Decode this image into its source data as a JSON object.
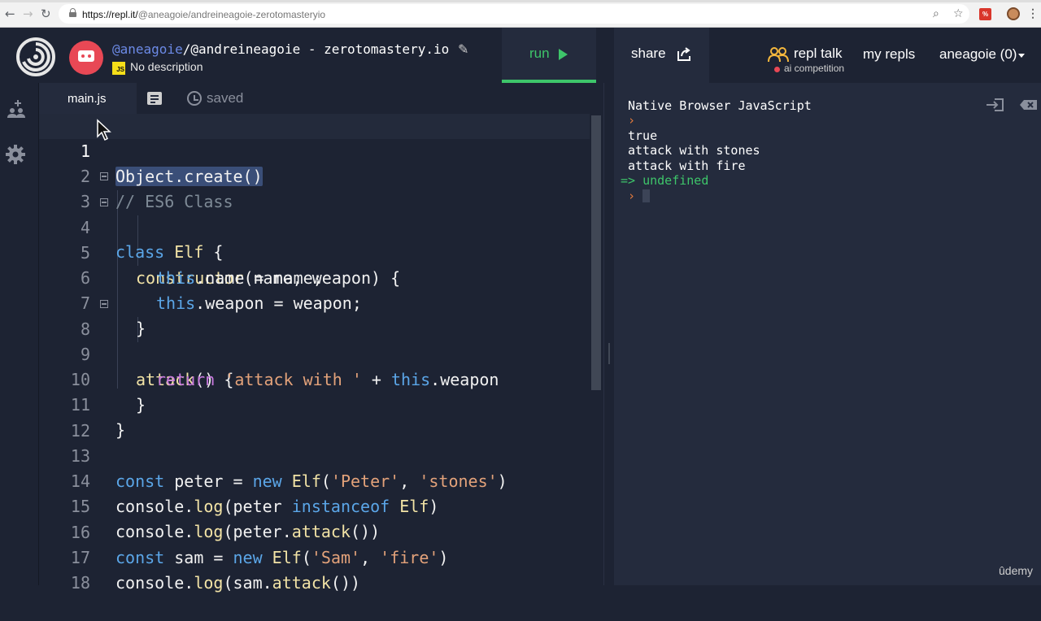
{
  "browser": {
    "url_host": "https://repl.it/",
    "url_path": "@aneagoie/andreineagoie-zerotomasteryio"
  },
  "header": {
    "owner": "@aneagoie",
    "separator": "/",
    "project_name": "@andreineagoie - zerotomastery.io",
    "description": "No description",
    "language_badge": "JS",
    "run_label": "run",
    "share_label": "share",
    "repl_talk_label": "repl talk",
    "ai_competition_label": "ai competition",
    "my_repls_label": "my repls",
    "user_label": "aneagoie (0)"
  },
  "editor": {
    "file_tab": "main.js",
    "saved_label": "saved",
    "lines": [
      {
        "n": "1"
      },
      {
        "n": "2"
      },
      {
        "n": "3"
      },
      {
        "n": "4"
      },
      {
        "n": "5"
      },
      {
        "n": "6"
      },
      {
        "n": "7"
      },
      {
        "n": "8"
      },
      {
        "n": "9"
      },
      {
        "n": "10"
      },
      {
        "n": "11"
      },
      {
        "n": "12"
      },
      {
        "n": "13"
      },
      {
        "n": "14"
      },
      {
        "n": "15"
      },
      {
        "n": "16"
      },
      {
        "n": "17"
      },
      {
        "n": "18"
      }
    ],
    "code": {
      "l1": "Object.create()",
      "l2": "// ES6 Class",
      "l3_kw": "class",
      "l3_name": "Elf",
      "l3_rest": " {",
      "l4_fn": "constructor",
      "l4_rest": "(name, weapon) {",
      "l5_this": "this",
      "l5_rest": ".name = name;",
      "l6_this": "this",
      "l6_rest": ".weapon = weapon;",
      "l7": "}",
      "l8_fn": "attack",
      "l8_rest": "() {",
      "l9_kw": "return",
      "l9_str": "'attack with '",
      "l9_op": " + ",
      "l9_this": "this",
      "l9_rest": ".weapon",
      "l10": "}",
      "l11": "}",
      "l13_kw": "const",
      "l13_a": " peter = ",
      "l13_new": "new",
      "l13_cls": " Elf",
      "l13_p1": "(",
      "l13_s1": "'Peter'",
      "l13_p2": ", ",
      "l13_s2": "'stones'",
      "l13_p3": ")",
      "l14_a": "console.",
      "l14_fn": "log",
      "l14_b": "(peter ",
      "l14_kw": "instanceof",
      "l14_cls": " Elf",
      "l14_c": ")",
      "l15_a": "console.",
      "l15_fn": "log",
      "l15_b": "(peter.",
      "l15_fn2": "attack",
      "l15_c": "())",
      "l16_kw": "const",
      "l16_a": " sam = ",
      "l16_new": "new",
      "l16_cls": " Elf",
      "l16_p1": "(",
      "l16_s1": "'Sam'",
      "l16_p2": ", ",
      "l16_s2": "'fire'",
      "l16_p3": ")",
      "l17_a": "console.",
      "l17_fn": "log",
      "l17_b": "(sam.",
      "l17_fn2": "attack",
      "l17_c": "())"
    }
  },
  "console": {
    "header": "Native Browser JavaScript",
    "prompt": "›",
    "output": [
      "true",
      "attack with stones",
      "attack with fire"
    ],
    "result_arrow": "=>",
    "result_value": "undefined"
  },
  "watermark": "ûdemy",
  "colors": {
    "background": "#1d2333",
    "panel": "#242b3d",
    "accent_run": "#3ec56a",
    "avatar_red": "#e84855"
  }
}
